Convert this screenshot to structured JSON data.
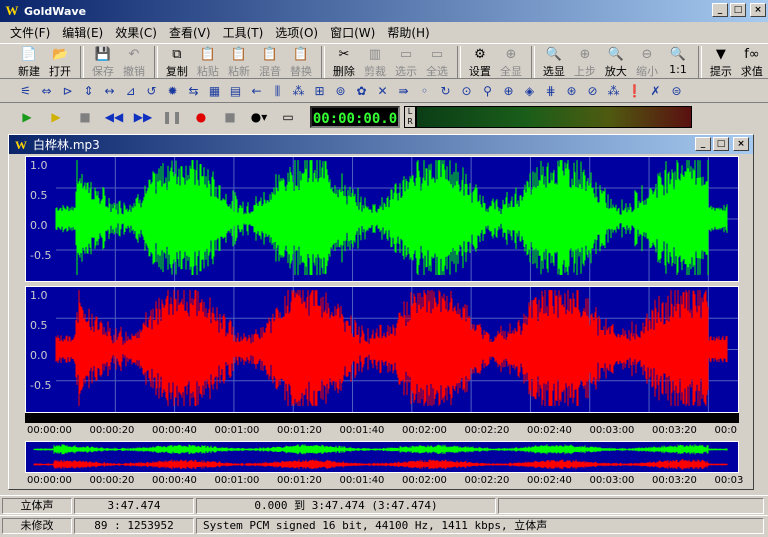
{
  "app_title": "GoldWave",
  "menu": [
    "文件(F)",
    "编辑(E)",
    "效果(C)",
    "查看(V)",
    "工具(T)",
    "选项(O)",
    "窗口(W)",
    "帮助(H)"
  ],
  "toolbar": [
    {
      "label": "新建",
      "icon": "new-file-icon",
      "glyph": "📄",
      "enabled": true
    },
    {
      "label": "打开",
      "icon": "open-folder-icon",
      "glyph": "📂",
      "enabled": true
    },
    {
      "label": "保存",
      "icon": "save-disk-icon",
      "glyph": "💾",
      "enabled": false
    },
    {
      "label": "撤销",
      "icon": "undo-icon",
      "glyph": "↶",
      "enabled": false
    },
    {
      "label": "复制",
      "icon": "copy-icon",
      "glyph": "⧉",
      "enabled": true
    },
    {
      "label": "粘贴",
      "icon": "paste-icon",
      "glyph": "📋",
      "enabled": false
    },
    {
      "label": "粘新",
      "icon": "paste-new-icon",
      "glyph": "📋",
      "enabled": false
    },
    {
      "label": "混音",
      "icon": "mix-icon",
      "glyph": "📋",
      "enabled": false
    },
    {
      "label": "替换",
      "icon": "replace-icon",
      "glyph": "📋",
      "enabled": false
    },
    {
      "label": "删除",
      "icon": "delete-icon",
      "glyph": "✂",
      "enabled": true
    },
    {
      "label": "剪裁",
      "icon": "trim-icon",
      "glyph": "▥",
      "enabled": false
    },
    {
      "label": "选示",
      "icon": "select-view-icon",
      "glyph": "▭",
      "enabled": false
    },
    {
      "label": "全选",
      "icon": "select-all-icon",
      "glyph": "▭",
      "enabled": false
    },
    {
      "label": "设置",
      "icon": "settings-icon",
      "glyph": "⚙",
      "enabled": true
    },
    {
      "label": "全显",
      "icon": "show-all-icon",
      "glyph": "⊕",
      "enabled": false
    },
    {
      "label": "选显",
      "icon": "show-selection-icon",
      "glyph": "🔍",
      "enabled": true
    },
    {
      "label": "上步",
      "icon": "previous-zoom-icon",
      "glyph": "⊕",
      "enabled": false
    },
    {
      "label": "放大",
      "icon": "zoom-in-icon",
      "glyph": "🔍",
      "enabled": true
    },
    {
      "label": "缩小",
      "icon": "zoom-out-icon",
      "glyph": "⊖",
      "enabled": false
    },
    {
      "label": "1:1",
      "icon": "zoom-one-to-one-icon",
      "glyph": "🔍",
      "enabled": true
    },
    {
      "label": "提示",
      "icon": "cue-icon",
      "glyph": "▼",
      "enabled": true
    },
    {
      "label": "求值",
      "icon": "evaluate-icon",
      "glyph": "f∞",
      "enabled": true
    }
  ],
  "transport": {
    "time_display": "00:00:00.0",
    "meter_labels": [
      "L",
      "R"
    ]
  },
  "document": {
    "title": "白桦林.mp3"
  },
  "waveform": {
    "y_ticks": [
      "1.0",
      "0.5",
      "0.0",
      "-0.5"
    ],
    "left_color": "#00ff00",
    "right_color": "#ff0000",
    "background": "#0000a0"
  },
  "timeline_ticks": [
    "00:00:00",
    "00:00:20",
    "00:00:40",
    "00:01:00",
    "00:01:20",
    "00:01:40",
    "00:02:00",
    "00:02:20",
    "00:02:40",
    "00:03:00",
    "00:03:20",
    "00:0"
  ],
  "overview_ticks": [
    "00:00:00",
    "00:00:20",
    "00:00:40",
    "00:01:00",
    "00:01:20",
    "00:01:40",
    "00:02:00",
    "00:02:20",
    "00:02:40",
    "00:03:00",
    "00:03:20",
    "00:03"
  ],
  "status": {
    "channels": "立体声",
    "length": "3:47.474",
    "selection": "0.000 到 3:47.474 (3:47.474)",
    "modified": "未修改",
    "position": "89 : 1253952",
    "format": "System PCM signed 16 bit, 44100 Hz, 1411 kbps, 立体声"
  }
}
